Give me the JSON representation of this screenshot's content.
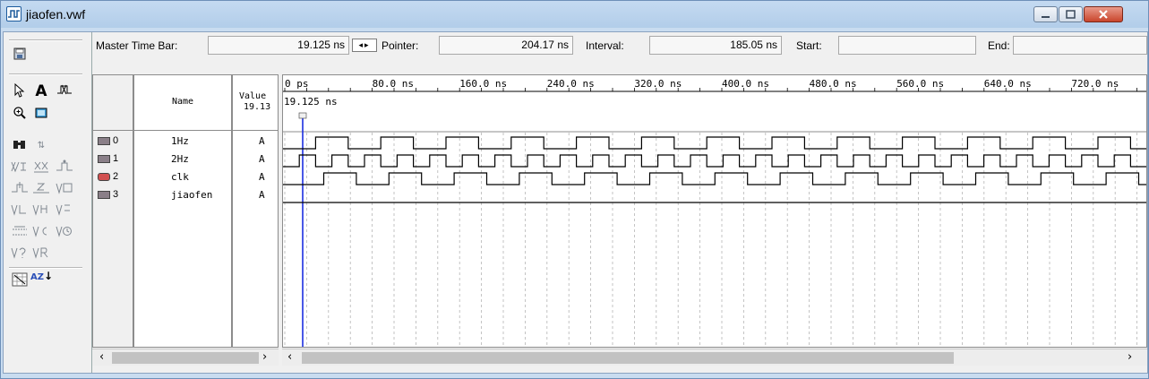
{
  "window": {
    "title": "jiaofen.vwf"
  },
  "toolbar": {
    "master_label": "Master Time Bar:",
    "master_value": "19.125 ns",
    "pointer_label": "Pointer:",
    "pointer_value": "204.17 ns",
    "interval_label": "Interval:",
    "interval_value": "185.05 ns",
    "start_label": "Start:",
    "start_value": "",
    "end_label": "End:",
    "end_value": ""
  },
  "columns": {
    "name": "Name",
    "value": "Value",
    "value_sub": "19.13"
  },
  "time_ruler": {
    "ticks": [
      "0 ps",
      "80.0 ns",
      "160.0 ns",
      "240.0 ns",
      "320.0 ns",
      "400.0 ns",
      "480.0 ns",
      "560.0 ns",
      "640.0 ns",
      "720.0 ns"
    ],
    "cursor_label": "19.125 ns"
  },
  "signals": [
    {
      "index": "0",
      "name": "1Hz",
      "value": "A",
      "pin": "input"
    },
    {
      "index": "1",
      "name": "2Hz",
      "value": "A",
      "pin": "input"
    },
    {
      "index": "2",
      "name": "clk",
      "value": "A",
      "pin": "input-clock"
    },
    {
      "index": "3",
      "name": "jiaofen",
      "value": "A",
      "pin": "input"
    }
  ],
  "tools": {
    "text_tool": "A",
    "sort": "AZ"
  }
}
